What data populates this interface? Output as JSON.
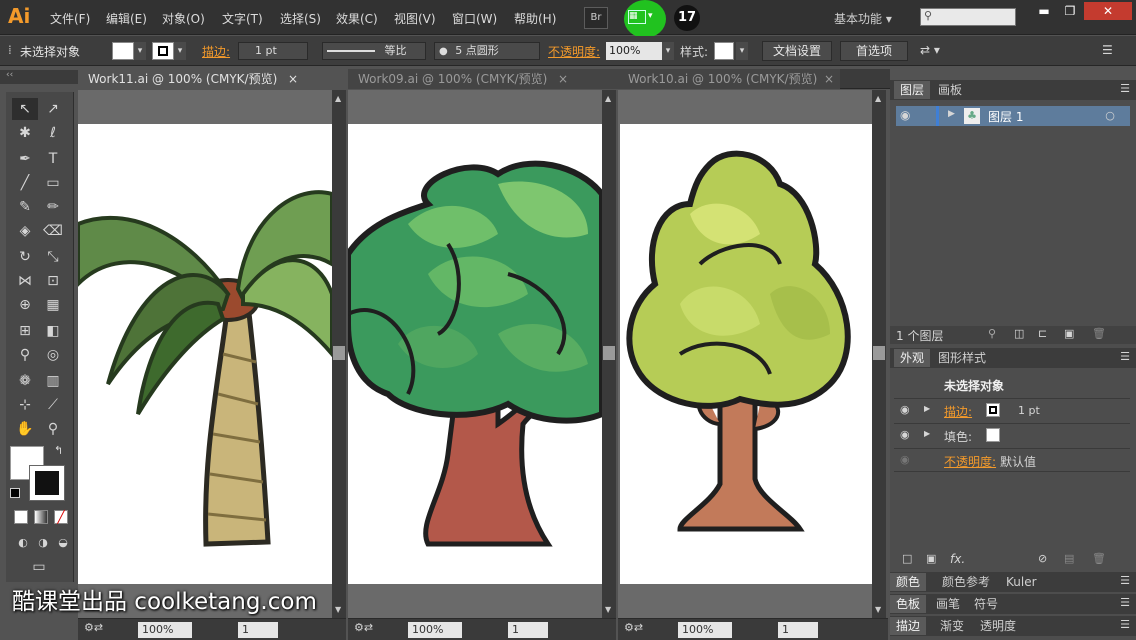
{
  "app": {
    "logo": "Ai",
    "menus": [
      "文件(F)",
      "编辑(E)",
      "对象(O)",
      "文字(T)",
      "选择(S)",
      "效果(C)",
      "视图(V)",
      "窗口(W)",
      "帮助(H)"
    ],
    "bridge_button": "Br",
    "step_badge": "17",
    "workspace": "基本功能",
    "win_minimize": "▬",
    "win_restore": "❐",
    "win_close": "✕"
  },
  "control": {
    "selection": "未选择对象",
    "stroke_label": "描边:",
    "stroke_weight": "1 pt",
    "stroke_profile": "等比",
    "brush": "5 点圆形",
    "opacity_label": "不透明度:",
    "opacity_value": "100%",
    "style_label": "样式:",
    "doc_setup": "文档设置",
    "preferences": "首选项"
  },
  "documents": [
    {
      "title": "Work11.ai @ 100% (CMYK/预览)",
      "zoom": "100%",
      "page": "1"
    },
    {
      "title": "Work09.ai @ 100% (CMYK/预览)",
      "zoom": "100%",
      "page": "1"
    },
    {
      "title": "Work10.ai @ 100% (CMYK/预览)",
      "zoom": "100%",
      "page": "1"
    }
  ],
  "layers": {
    "tabs": [
      "图层",
      "画板"
    ],
    "rows": [
      {
        "name": "图层 1"
      }
    ],
    "count": "1 个图层"
  },
  "appearance": {
    "tabs": [
      "外观",
      "图形样式"
    ],
    "title": "未选择对象",
    "stroke_label": "描边:",
    "stroke_value": "1 pt",
    "fill_label": "填色:",
    "opacity_label": "不透明度:",
    "opacity_value": "默认值",
    "fx": "fx."
  },
  "bottom_tabs": [
    [
      "颜色",
      "颜色参考",
      "Kuler"
    ],
    [
      "色板",
      "画笔",
      "符号"
    ],
    [
      "描边",
      "渐变",
      "透明度"
    ]
  ],
  "watermark": "酷课堂出品 coolketang.com",
  "colors": {
    "accent": "#f39a2b",
    "highlight": "#21c21f",
    "panel": "#4d4d4d"
  }
}
